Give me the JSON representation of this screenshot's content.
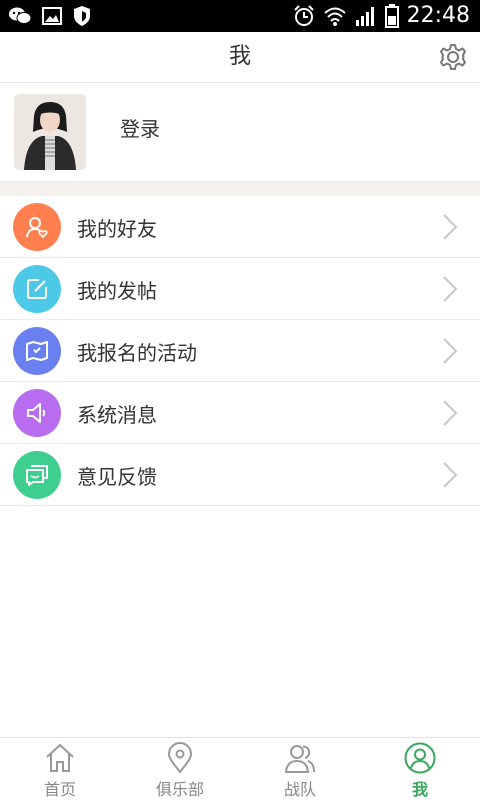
{
  "status_bar": {
    "time": "22:48",
    "icons": [
      "wechat-icon",
      "image-icon",
      "shield-icon",
      "alarm-icon",
      "wifi-icon",
      "signal-icon",
      "battery-icon"
    ]
  },
  "header": {
    "title": "我",
    "settings_icon": "gear-icon"
  },
  "profile": {
    "login_label": "登录"
  },
  "menu": {
    "items": [
      {
        "label": "我的好友",
        "icon": "friend-icon",
        "color": "#ff7f4f"
      },
      {
        "label": "我的发帖",
        "icon": "edit-icon",
        "color": "#4cc9e6"
      },
      {
        "label": "我报名的活动",
        "icon": "map-icon",
        "color": "#6b80f0"
      },
      {
        "label": "系统消息",
        "icon": "speaker-icon",
        "color": "#b86cf0"
      },
      {
        "label": "意见反馈",
        "icon": "feedback-icon",
        "color": "#3ecf8e"
      }
    ]
  },
  "tabbar": {
    "active_color": "#3aa85c",
    "tabs": [
      {
        "label": "首页",
        "icon": "home-icon"
      },
      {
        "label": "俱乐部",
        "icon": "location-icon"
      },
      {
        "label": "战队",
        "icon": "team-icon"
      },
      {
        "label": "我",
        "icon": "user-icon",
        "active": true
      }
    ]
  }
}
